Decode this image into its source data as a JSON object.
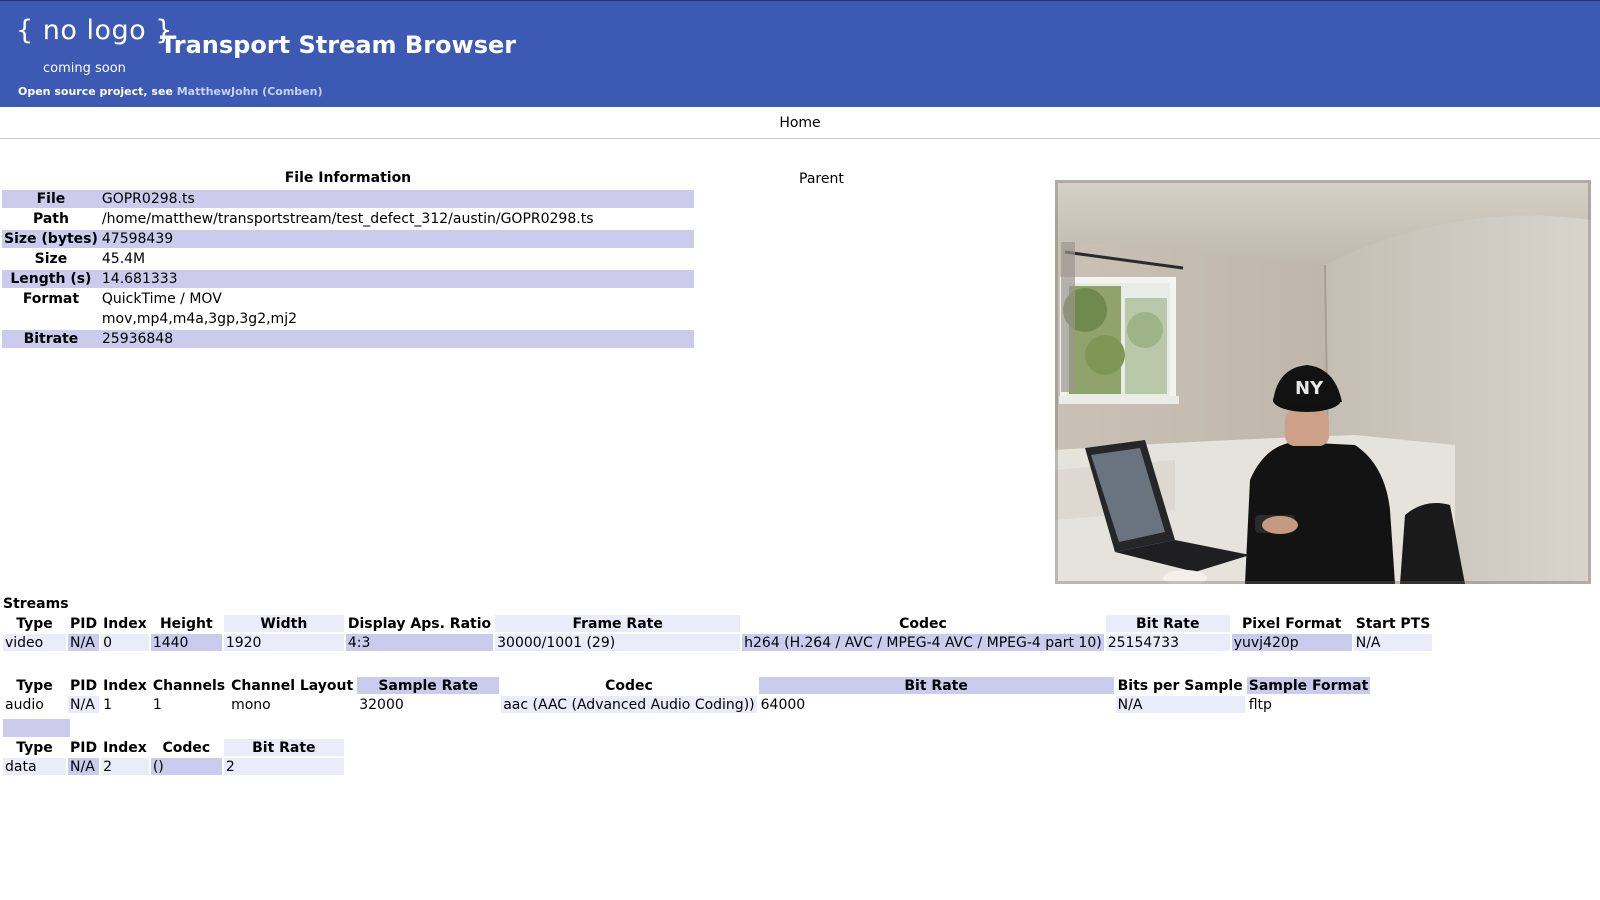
{
  "header": {
    "logo_text": "{ no logo }",
    "logo_sub": "coming soon",
    "title": "Transport Stream Browser",
    "credit_prefix": "Open source project, see ",
    "credit_link": "MatthewJohn (Comben)"
  },
  "nav": {
    "home": "Home"
  },
  "file_info": {
    "caption": "File Information",
    "rows": [
      {
        "label": "File",
        "value": "GOPR0298.ts"
      },
      {
        "label": "Path",
        "value": "/home/matthew/transportstream/test_defect_312/austin/GOPR0298.ts"
      },
      {
        "label": "Size (bytes)",
        "value": "47598439"
      },
      {
        "label": "Size",
        "value": "45.4M"
      },
      {
        "label": "Length (s)",
        "value": "14.681333"
      },
      {
        "label": "Format",
        "value": "QuickTime / MOV"
      },
      {
        "label": "",
        "value": "mov,mp4,m4a,3gp,3g2,mj2"
      },
      {
        "label": "Bitrate",
        "value": "25936848"
      }
    ]
  },
  "parent_label": "Parent",
  "streams": {
    "label": "Streams",
    "video": {
      "headers": [
        "Type",
        "PID",
        "Index",
        "Height",
        "Width",
        "Display Aps. Ratio",
        "Frame Rate",
        "Codec",
        "Bit Rate",
        "Pixel Format",
        "Start PTS"
      ],
      "row": [
        "video",
        "N/A",
        "0",
        "1440",
        "1920",
        "4:3",
        "30000/1001 (29)",
        "h264 (H.264 / AVC / MPEG-4 AVC / MPEG-4 part 10)",
        "25154733",
        "yuvj420p",
        "N/A"
      ]
    },
    "audio": {
      "headers": [
        "Type",
        "PID",
        "Index",
        "Channels",
        "Channel Layout",
        "Sample Rate",
        "Codec",
        "Bit Rate",
        "Bits per Sample",
        "Sample Format"
      ],
      "row": [
        "audio",
        "N/A",
        "1",
        "1",
        "mono",
        "32000",
        "aac (AAC (Advanced Audio Coding))",
        "64000",
        "N/A",
        "fltp"
      ]
    },
    "data": {
      "headers": [
        "Type",
        "PID",
        "Index",
        "Codec",
        "Bit Rate"
      ],
      "row": [
        "data",
        "N/A",
        "2",
        "()",
        "2"
      ]
    }
  },
  "colors": {
    "header_bg": "#3c5ab4",
    "row_shade": "#cccbee",
    "cell_light": "#ecebfa",
    "link": "#c6d2f7"
  }
}
